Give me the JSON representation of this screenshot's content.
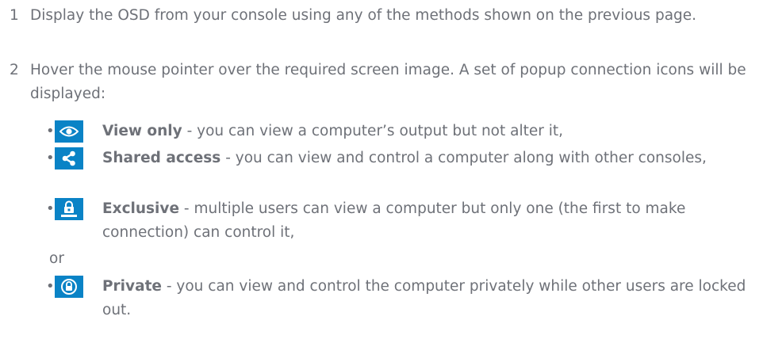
{
  "steps": [
    {
      "number": "1",
      "text": "Display the OSD from your console using any of the methods shown on the previous page."
    },
    {
      "number": "2",
      "text": "Hover the mouse pointer over the required screen image. A set of popup connection icons will be displayed:"
    }
  ],
  "bullets": [
    {
      "icon": "eye-icon",
      "title": "View only",
      "description": " - you can view a computer’s output but not alter it,"
    },
    {
      "icon": "share-icon",
      "title": "Shared access",
      "description": " - you can view and control a computer along with other consoles,"
    },
    {
      "icon": "user-lock-icon",
      "title": "Exclusive",
      "description": " - multiple users can view a computer but only one (the first to make connection) can control it,"
    },
    {
      "icon": "padlock-icon",
      "title": "Private",
      "description": " - you can view and control the computer privately while other users are locked out."
    }
  ],
  "or_text": "or",
  "colors": {
    "text": "#6e7178",
    "icon_background": "#0a83c6",
    "icon_foreground": "#ffffff"
  }
}
